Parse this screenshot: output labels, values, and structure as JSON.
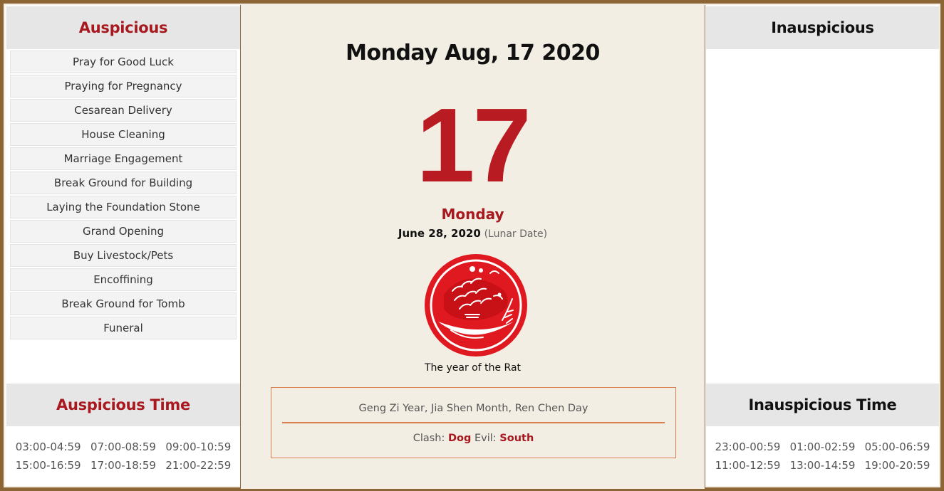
{
  "colors": {
    "frame": "#8b6535",
    "accent_red": "#a8191f",
    "big_day_red": "#b81c22",
    "box_border": "#d9804e"
  },
  "auspicious": {
    "title": "Auspicious",
    "items": [
      "Pray for Good Luck",
      "Praying for Pregnancy",
      "Cesarean Delivery",
      "House Cleaning",
      "Marriage Engagement",
      "Break Ground for Building",
      "Laying the Foundation Stone",
      "Grand Opening",
      "Buy Livestock/Pets",
      "Encoffining",
      "Break Ground for Tomb",
      "Funeral"
    ]
  },
  "auspicious_time": {
    "title": "Auspicious Time",
    "times": [
      "03:00-04:59",
      "07:00-08:59",
      "09:00-10:59",
      "15:00-16:59",
      "17:00-18:59",
      "21:00-22:59"
    ]
  },
  "inauspicious": {
    "title": "Inauspicious",
    "items": []
  },
  "inauspicious_time": {
    "title": "Inauspicious Time",
    "times": [
      "23:00-00:59",
      "01:00-02:59",
      "05:00-06:59",
      "11:00-12:59",
      "13:00-14:59",
      "19:00-20:59"
    ]
  },
  "center": {
    "full_date": "Monday Aug, 17 2020",
    "day_number": "17",
    "weekday": "Monday",
    "lunar_date": "June 28, 2020",
    "lunar_note": "(Lunar Date)",
    "zodiac_icon": "rat-papercut-icon",
    "zodiac_caption": "The year of the Rat",
    "ganzhi": "Geng Zi Year, Jia Shen Month, Ren Chen Day",
    "clash_label": "Clash:",
    "clash_value": "Dog",
    "evil_label": "Evil:",
    "evil_value": "South"
  }
}
